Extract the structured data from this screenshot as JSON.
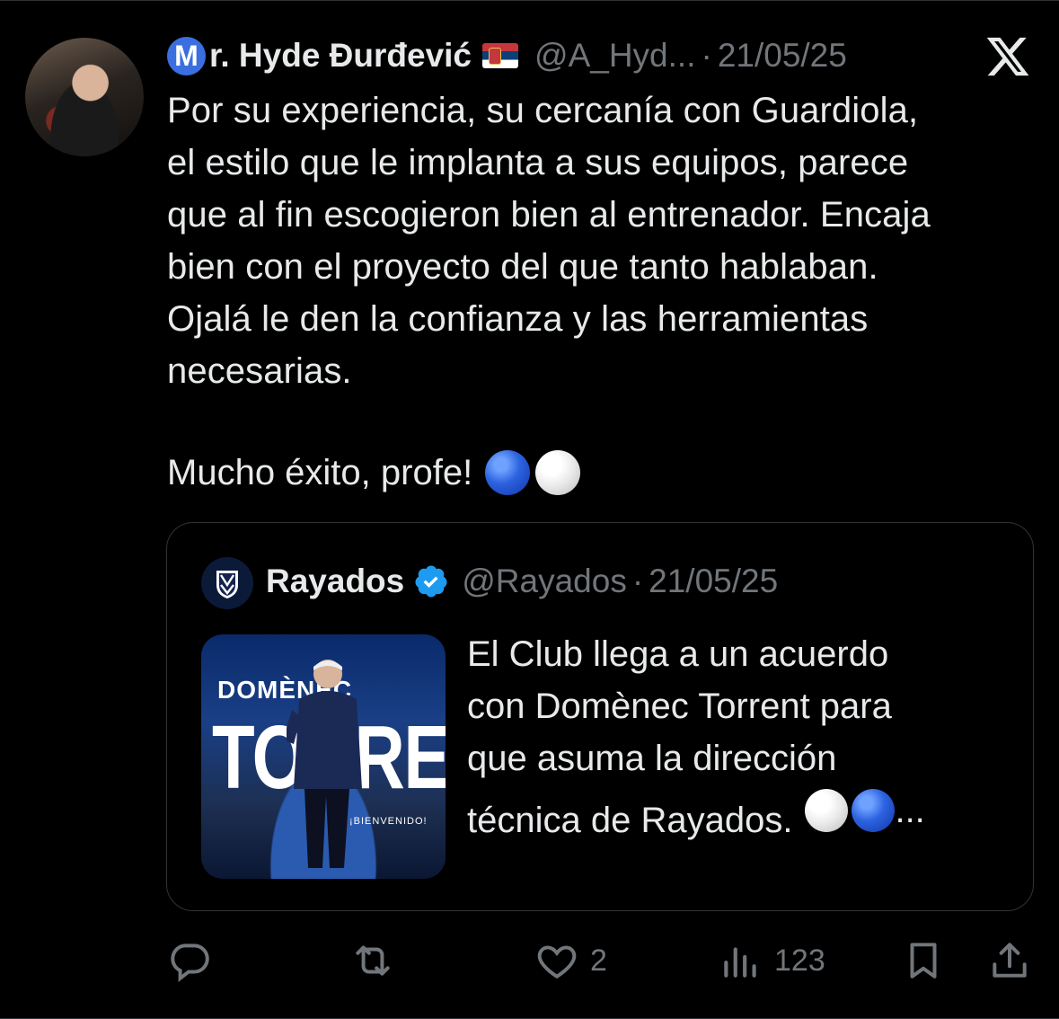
{
  "tweet": {
    "display_name_badge": "M",
    "display_name": "r. Hyde Đurđević",
    "handle": "@A_Hyd...",
    "dot": "·",
    "date": "21/05/25",
    "body": "Por su experiencia, su cercanía con Guardiola,\nel estilo que le implanta a sus equipos, parece\nque al fin escogieron bien al entrenador. Encaja\nbien con el proyecto del que tanto hablaban.\nOjalá le den la confianza y las herramientas\nnecesarias.",
    "body_closing": "Mucho éxito, profe!"
  },
  "quote": {
    "name": "Rayados",
    "handle": "@Rayados",
    "dot": "·",
    "date": "21/05/25",
    "text": "El Club llega a un acuerdo\ncon Domènec Torrent para\nque asuma la dirección\ntécnica de Rayados.",
    "ellipsis": "...",
    "image": {
      "line1": "DOMÈNEC",
      "line2": "TORRENT",
      "line3": "¡BIENVENIDO!"
    }
  },
  "actions": {
    "likes": "2",
    "views": "123"
  },
  "colors": {
    "background": "#000000",
    "text": "#e7e9ea",
    "muted": "#71767b",
    "verified": "#1d9bf0",
    "border": "#2f3336"
  }
}
